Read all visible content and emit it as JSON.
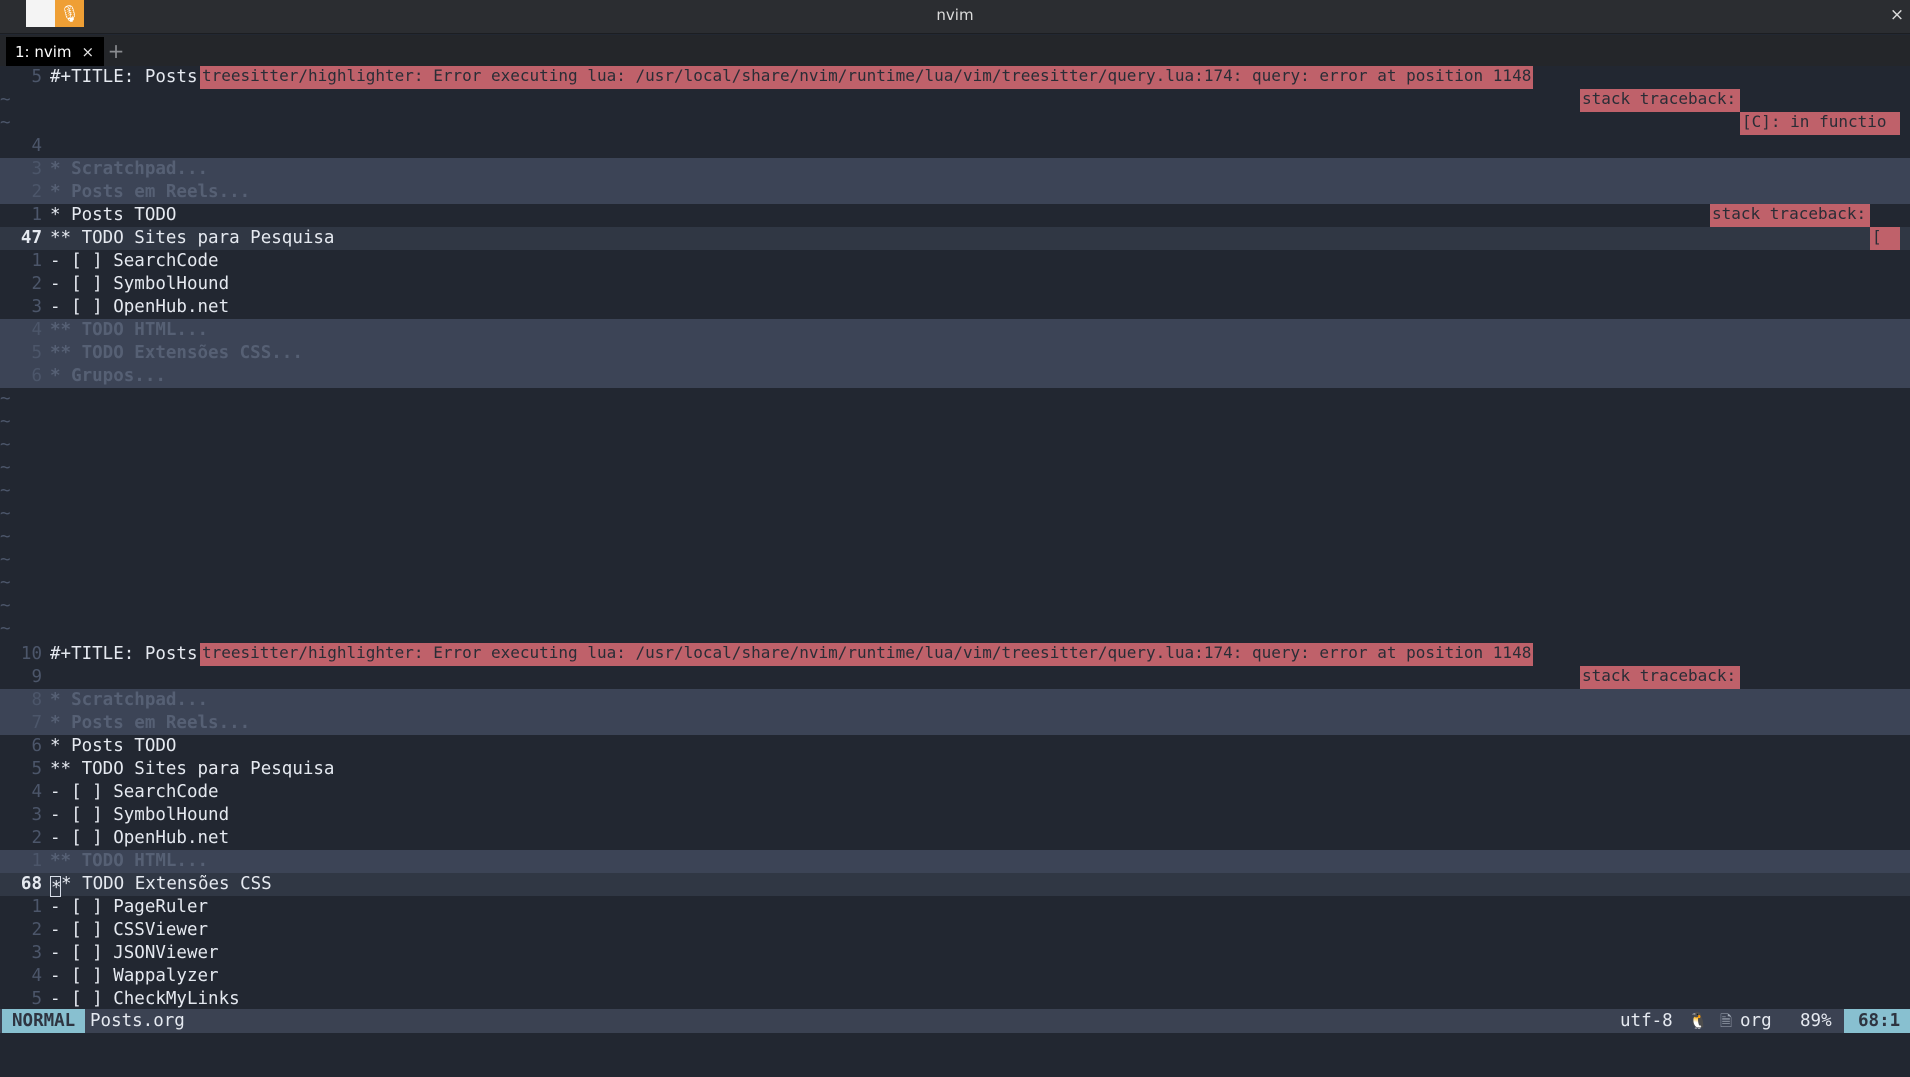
{
  "window": {
    "title": "nvim",
    "close_glyph": "×",
    "app_icon_glyph": "🎙"
  },
  "tabs": [
    {
      "label": "1: nvim",
      "close_glyph": "×"
    }
  ],
  "new_tab_glyph": "+",
  "top_pane": {
    "lines": [
      {
        "num": "5",
        "text": "#+TITLE: Posts",
        "fold": false,
        "current": false
      },
      {
        "num": "~",
        "text": "",
        "tilde": true
      },
      {
        "num": "~",
        "text": "",
        "tilde": true
      },
      {
        "num": "4",
        "text": ""
      },
      {
        "num": "3",
        "text": "* Scratchpad...",
        "fold": true
      },
      {
        "num": "2",
        "text": "* Posts em Reels...",
        "fold": true
      },
      {
        "num": "1",
        "text": "* Posts TODO"
      },
      {
        "num": "47",
        "text": "** TODO Sites para Pesquisa",
        "current": true
      },
      {
        "num": "1",
        "text": "- [ ] SearchCode"
      },
      {
        "num": "2",
        "text": "- [ ] SymbolHound"
      },
      {
        "num": "3",
        "text": "- [ ] OpenHub.net"
      },
      {
        "num": "4",
        "text": "** TODO HTML...",
        "fold": true
      },
      {
        "num": "5",
        "text": "** TODO Extensões CSS...",
        "fold": true
      },
      {
        "num": "6",
        "text": "* Grupos...",
        "fold": true
      }
    ],
    "tilde_count": 11,
    "errors": [
      {
        "row": 0,
        "text": "treesitter/highlighter: Error executing lua: /usr/local/share/nvim/runtime/lua/vim/treesitter/query.lua:174: query: error at position 1148"
      },
      {
        "row": 1,
        "text": "stack traceback:"
      },
      {
        "row": 2,
        "text": "[C]: in functio"
      },
      {
        "row": 6,
        "text": "stack traceback:"
      },
      {
        "row": 7,
        "text": "["
      }
    ]
  },
  "bottom_pane": {
    "lines": [
      {
        "num": "10",
        "text": "#+TITLE: Posts"
      },
      {
        "num": "9",
        "text": ""
      },
      {
        "num": "8",
        "text": "* Scratchpad...",
        "fold": true
      },
      {
        "num": "7",
        "text": "* Posts em Reels...",
        "fold": true
      },
      {
        "num": "6",
        "text": "* Posts TODO"
      },
      {
        "num": "5",
        "text": "** TODO Sites para Pesquisa"
      },
      {
        "num": "4",
        "text": "- [ ] SearchCode"
      },
      {
        "num": "3",
        "text": "- [ ] SymbolHound"
      },
      {
        "num": "2",
        "text": "- [ ] OpenHub.net"
      },
      {
        "num": "1",
        "text": "** TODO HTML...",
        "fold": true
      },
      {
        "num": "68",
        "text": "** TODO Extensões CSS",
        "current": true,
        "cursor_col": 0
      },
      {
        "num": "1",
        "text": "- [ ] PageRuler"
      },
      {
        "num": "2",
        "text": "- [ ] CSSViewer"
      },
      {
        "num": "3",
        "text": "- [ ] JSONViewer"
      },
      {
        "num": "4",
        "text": "- [ ] Wappalyzer"
      },
      {
        "num": "5",
        "text": "- [ ] CheckMyLinks"
      }
    ],
    "errors": [
      {
        "row": 0,
        "text": "treesitter/highlighter: Error executing lua: /usr/local/share/nvim/runtime/lua/vim/treesitter/query.lua:174: query: error at position 1148"
      },
      {
        "row": 1,
        "text": "stack traceback:"
      }
    ]
  },
  "statusline": {
    "mode": "NORMAL",
    "filename": "Posts.org",
    "encoding": "utf-8",
    "os_icon": "linux-icon",
    "os_glyph": "🐧",
    "filetype_icon": "file-icon",
    "filetype_glyph": "🗎",
    "filetype": "org",
    "percent": "89%",
    "position": "68:1"
  },
  "colors": {
    "background": "#222731",
    "fold": "#3c4456",
    "error": "#bf616a",
    "accent": "#88c0d0"
  }
}
